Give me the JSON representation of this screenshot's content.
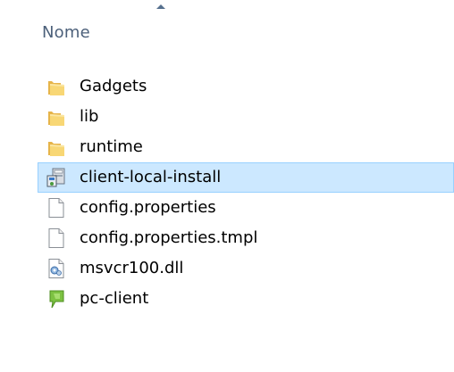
{
  "header": {
    "name_column_label": "Nome"
  },
  "files": [
    {
      "name": "Gadgets",
      "icon": "folder-icon"
    },
    {
      "name": "lib",
      "icon": "folder-icon"
    },
    {
      "name": "runtime",
      "icon": "folder-icon"
    },
    {
      "name": "client-local-install",
      "icon": "installer-icon",
      "selected": true
    },
    {
      "name": "config.properties",
      "icon": "blank-file-icon"
    },
    {
      "name": "config.properties.tmpl",
      "icon": "blank-file-icon"
    },
    {
      "name": "msvcr100.dll",
      "icon": "dll-file-icon"
    },
    {
      "name": "pc-client",
      "icon": "pc-client-app-icon"
    }
  ],
  "colors": {
    "selection_background": "#cce8ff",
    "selection_border": "#99d1ff",
    "header_text": "#4c607a"
  }
}
